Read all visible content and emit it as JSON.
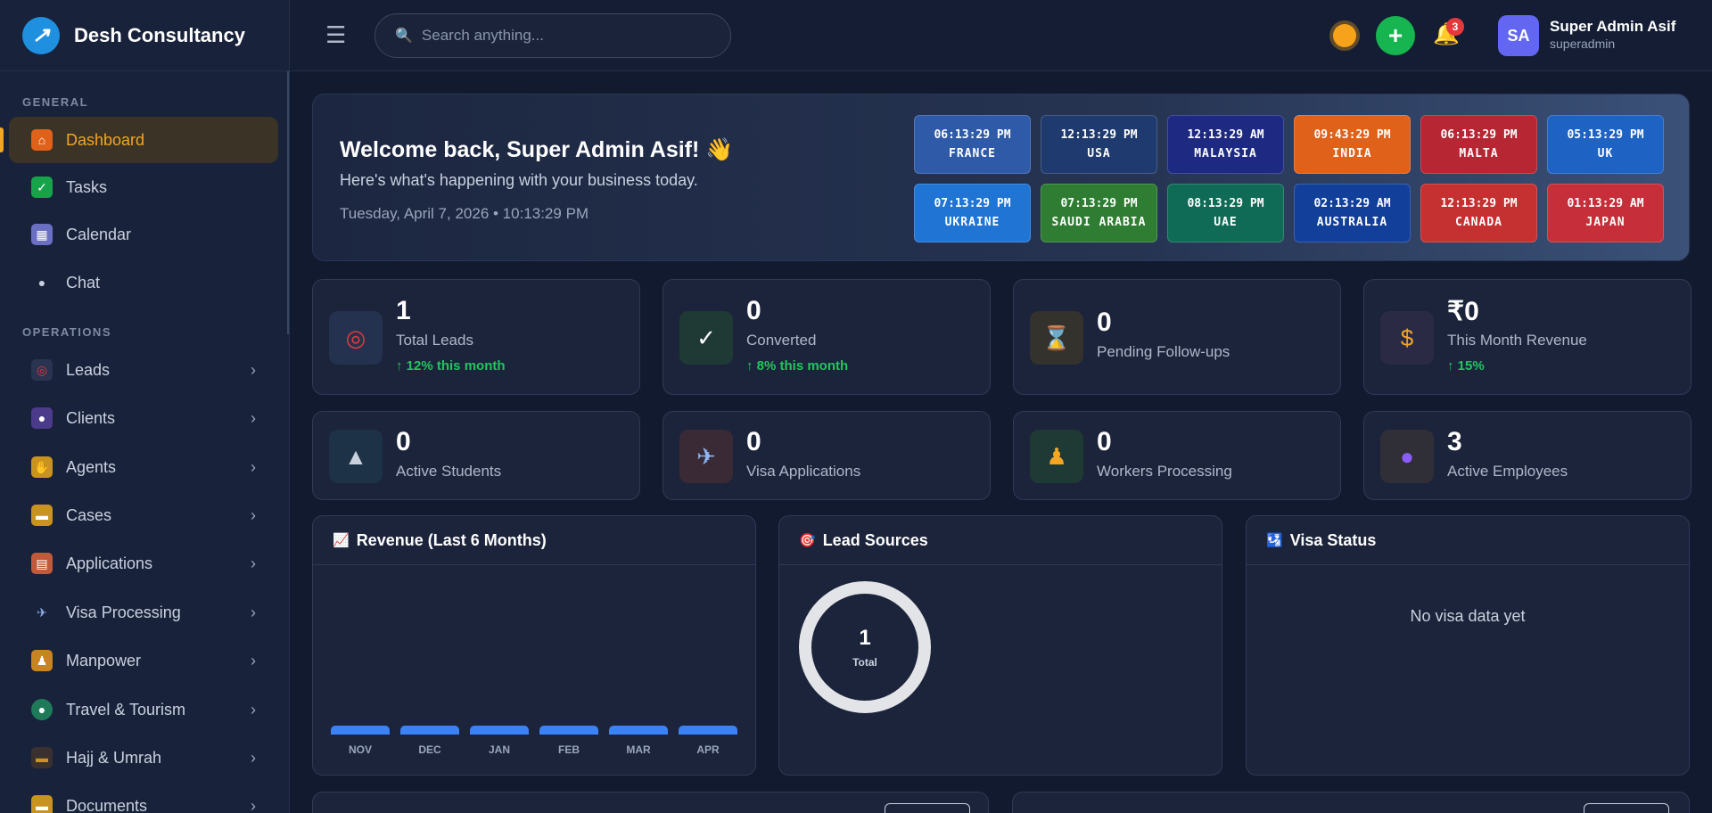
{
  "brand": {
    "name": "Desh Consultancy"
  },
  "sidebar": {
    "sections": {
      "general": "GENERAL",
      "operations": "OPERATIONS"
    },
    "items": [
      {
        "label": "Dashboard",
        "icon": "house-icon",
        "active": true
      },
      {
        "label": "Tasks",
        "icon": "check-icon"
      },
      {
        "label": "Calendar",
        "icon": "calendar-icon"
      },
      {
        "label": "Chat",
        "icon": "speech-bubble-icon"
      },
      {
        "label": "Leads",
        "icon": "target-icon"
      },
      {
        "label": "Clients",
        "icon": "users-icon"
      },
      {
        "label": "Agents",
        "icon": "handshake-icon"
      },
      {
        "label": "Cases",
        "icon": "folder-icon"
      },
      {
        "label": "Applications",
        "icon": "document-icon"
      },
      {
        "label": "Visa Processing",
        "icon": "airplane-icon"
      },
      {
        "label": "Manpower",
        "icon": "worker-icon"
      },
      {
        "label": "Travel & Tourism",
        "icon": "globe-icon"
      },
      {
        "label": "Hajj & Umrah",
        "icon": "kaaba-icon"
      },
      {
        "label": "Documents",
        "icon": "folder-icon"
      }
    ]
  },
  "header": {
    "search_placeholder": "Search anything...",
    "notification_count": "3",
    "user": {
      "initials": "SA",
      "name": "Super Admin Asif",
      "role": "superadmin"
    }
  },
  "welcome": {
    "title": "Welcome back, Super Admin Asif! 👋",
    "subtitle": "Here's what's happening with your business today.",
    "date": "Tuesday, April 7, 2026 • 10:13:29 PM"
  },
  "clocks": [
    {
      "time": "06:13:29 PM",
      "country": "FRANCE",
      "color": "#2e5aa8"
    },
    {
      "time": "12:13:29 PM",
      "country": "USA",
      "color": "#1e3a6e"
    },
    {
      "time": "12:13:29 AM",
      "country": "MALAYSIA",
      "color": "#1e2a82"
    },
    {
      "time": "09:43:29 PM",
      "country": "INDIA",
      "color": "#e0611a"
    },
    {
      "time": "06:13:29 PM",
      "country": "MALTA",
      "color": "#b62633"
    },
    {
      "time": "05:13:29 PM",
      "country": "UK",
      "color": "#1e63c4"
    },
    {
      "time": "07:13:29 PM",
      "country": "UKRAINE",
      "color": "#1f74d4"
    },
    {
      "time": "07:13:29 PM",
      "country": "SAUDI ARABIA",
      "color": "#2e7d32"
    },
    {
      "time": "08:13:29 PM",
      "country": "UAE",
      "color": "#0f6b56"
    },
    {
      "time": "02:13:29 AM",
      "country": "AUSTRALIA",
      "color": "#123f9a"
    },
    {
      "time": "12:13:29 PM",
      "country": "CANADA",
      "color": "#c53030"
    },
    {
      "time": "01:13:29 AM",
      "country": "JAPAN",
      "color": "#c62e3a"
    }
  ],
  "stats": [
    {
      "value": "1",
      "label": "Total Leads",
      "trend": "↑ 12% this month",
      "icon": "target-icon",
      "iconbg": "#24324f"
    },
    {
      "value": "0",
      "label": "Converted",
      "trend": "↑ 8% this month",
      "icon": "check-icon",
      "iconbg": "#1f3a35"
    },
    {
      "value": "0",
      "label": "Pending Follow-ups",
      "trend": "",
      "icon": "hourglass-icon",
      "iconbg": "#34322d"
    },
    {
      "value": "₹0",
      "label": "This Month Revenue",
      "trend": "↑ 15%",
      "icon": "money-bag-icon",
      "iconbg": "#2a2a44"
    },
    {
      "value": "0",
      "label": "Active Students",
      "trend": "",
      "icon": "graduation-cap-icon",
      "iconbg": "#1e3247"
    },
    {
      "value": "0",
      "label": "Visa Applications",
      "trend": "",
      "icon": "airplane-icon",
      "iconbg": "#3a2a36"
    },
    {
      "value": "0",
      "label": "Workers Processing",
      "trend": "",
      "icon": "worker-icon",
      "iconbg": "#1f3a35"
    },
    {
      "value": "3",
      "label": "Active Employees",
      "trend": "",
      "icon": "users-icon",
      "iconbg": "#302e36"
    }
  ],
  "panels": {
    "revenue": {
      "title": "Revenue (Last 6 Months)"
    },
    "leads": {
      "title": "Lead Sources",
      "total_value": "1",
      "total_label": "Total"
    },
    "visa": {
      "title": "Visa Status",
      "empty": "No visa data yet"
    }
  },
  "chart_data": {
    "type": "bar",
    "title": "Revenue (Last 6 Months)",
    "categories": [
      "NOV",
      "DEC",
      "JAN",
      "FEB",
      "MAR",
      "APR"
    ],
    "values": [
      0,
      0,
      0,
      0,
      0,
      0
    ]
  }
}
